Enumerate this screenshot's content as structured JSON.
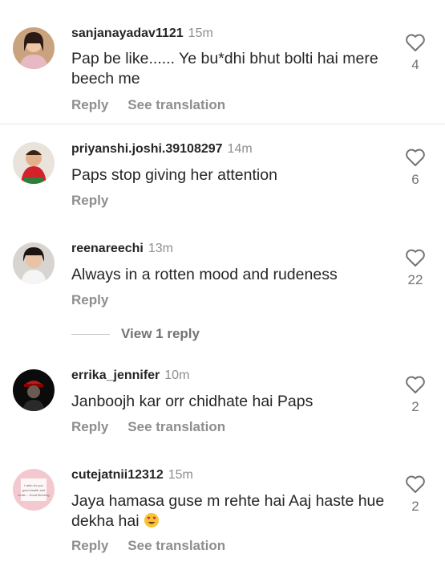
{
  "comments": [
    {
      "username": "sanjanayadav1121",
      "time": "15m",
      "text": "Pap be like...... Ye bu*dhi bhut bolti hai mere beech me",
      "reply_label": "Reply",
      "translate_label": "See translation",
      "likes": "4"
    },
    {
      "username": "priyanshi.joshi.39108297",
      "time": "14m",
      "text": "Paps stop giving her attention",
      "reply_label": "Reply",
      "likes": "6"
    },
    {
      "username": "reenareechi",
      "time": "13m",
      "text": "Always in a rotten mood and rudeness",
      "reply_label": "Reply",
      "view_replies_label": "View 1 reply",
      "likes": "22"
    },
    {
      "username": "errika_jennifer",
      "time": "10m",
      "text": "Janboojh kar orr chidhate hai Paps",
      "reply_label": "Reply",
      "translate_label": "See translation",
      "likes": "2"
    },
    {
      "username": "cutejatnii12312",
      "time": "15m",
      "text": "Jaya hamasa guse m rehte hai Aaj haste hue dekha hai",
      "reply_label": "Reply",
      "translate_label": "See translation",
      "likes": "2"
    }
  ],
  "avatar_card_text": "I wish for you good health and smile... Good Morning",
  "icons": {
    "like": "heart-outline-icon",
    "emoji": "heart-eyes-emoji-icon"
  }
}
